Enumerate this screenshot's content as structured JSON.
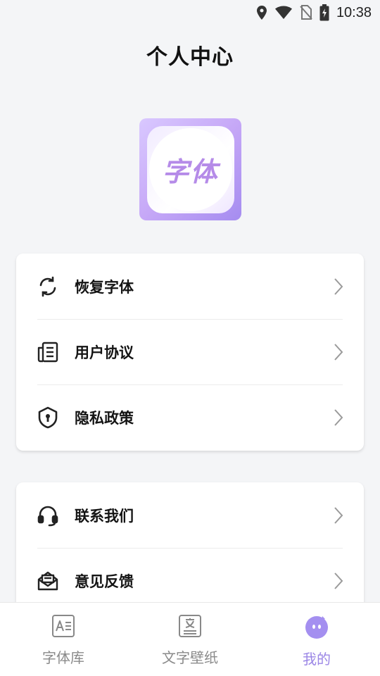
{
  "status_bar": {
    "time": "10:38",
    "icons": [
      "location-icon",
      "wifi-icon",
      "no-sim-icon",
      "battery-charging-icon"
    ]
  },
  "page": {
    "title": "个人中心"
  },
  "logo": {
    "text": "字体",
    "icon": "app-logo"
  },
  "menu_group_1": [
    {
      "label": "恢复字体",
      "icon": "refresh-icon"
    },
    {
      "label": "用户协议",
      "icon": "document-icon"
    },
    {
      "label": "隐私政策",
      "icon": "shield-icon"
    }
  ],
  "menu_group_2": [
    {
      "label": "联系我们",
      "icon": "headset-icon"
    },
    {
      "label": "意见反馈",
      "icon": "mail-icon"
    }
  ],
  "tabbar": {
    "tabs": [
      {
        "label": "字体库",
        "icon": "font-library-icon",
        "active": false
      },
      {
        "label": "文字壁纸",
        "icon": "text-wallpaper-icon",
        "active": false
      },
      {
        "label": "我的",
        "icon": "profile-face-icon",
        "active": true
      }
    ]
  },
  "colors": {
    "accent": "#9b86e6",
    "background": "#f4f5f7",
    "tab_inactive": "#8a8a8a"
  }
}
